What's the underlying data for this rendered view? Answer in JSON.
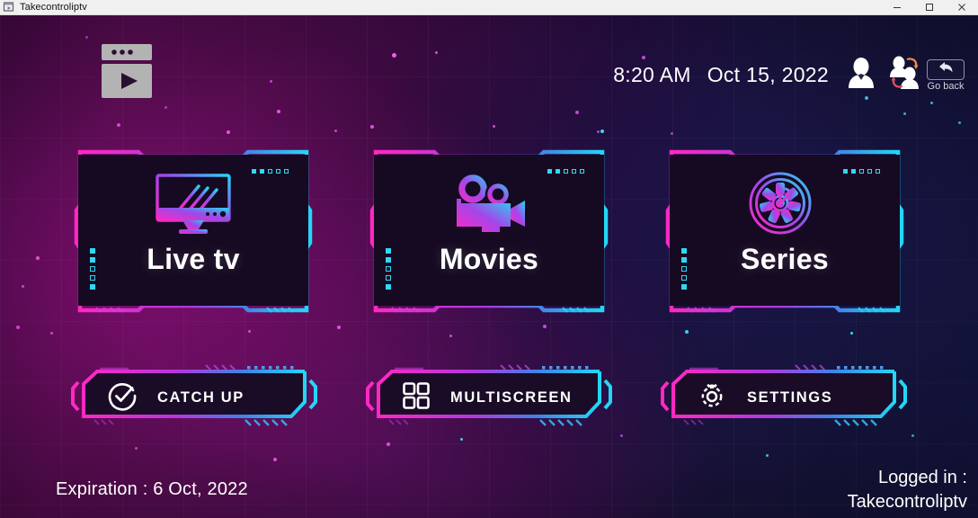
{
  "window": {
    "title": "Takecontroliptv",
    "icon": "app-window-icon",
    "controls": [
      {
        "name": "minimize-button",
        "glyph": "minimize-icon"
      },
      {
        "name": "maximize-button",
        "glyph": "maximize-icon"
      },
      {
        "name": "close-button",
        "glyph": "close-icon"
      }
    ]
  },
  "colors": {
    "magenta": "#ff28c3",
    "pink": "#f62ea7",
    "cyan": "#24d6f5",
    "blue": "#2f7ae0",
    "purple": "#9b3bd6",
    "card_bg": "#150a22",
    "text": "#ffffff"
  },
  "header": {
    "logo_name": "takecontroliptv-logo",
    "time": "8:20 AM",
    "date": "Oct 15, 2022",
    "user_icon": "user-icon",
    "switch_user_icon": "switch-user-icon",
    "go_back": {
      "icon": "back-arrow-icon",
      "label": "Go back"
    }
  },
  "main": {
    "cards": [
      {
        "id": "live-tv",
        "label": "Live tv",
        "icon": "tv-icon"
      },
      {
        "id": "movies",
        "label": "Movies",
        "icon": "movie-camera-icon"
      },
      {
        "id": "series",
        "label": "Series",
        "icon": "film-reel-icon"
      }
    ],
    "actions": [
      {
        "id": "catch-up",
        "label": "CATCH UP",
        "icon": "check-circle-icon"
      },
      {
        "id": "multiscreen",
        "label": "MULTISCREEN",
        "icon": "grid-2x2-icon"
      },
      {
        "id": "settings",
        "label": "SETTINGS",
        "icon": "gear-icon"
      }
    ]
  },
  "footer": {
    "expiration": "Expiration : 6 Oct, 2022",
    "logged_in_label": "Logged in :",
    "logged_in_user": "Takecontroliptv"
  }
}
